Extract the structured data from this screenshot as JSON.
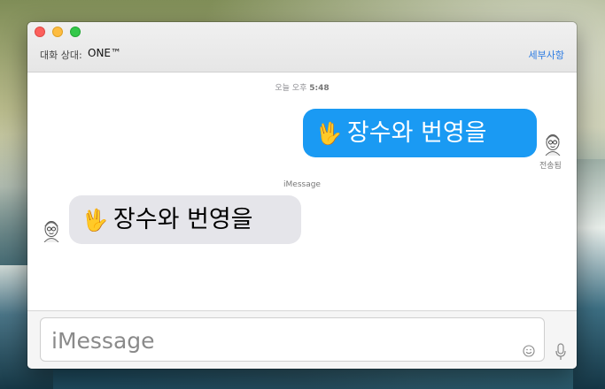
{
  "header": {
    "to_label": "대화 상대:",
    "recipient": "ONE™",
    "details_label": "세부사항"
  },
  "conversation": {
    "timestamp_prefix": "오늘 오후",
    "timestamp_time": "5:48",
    "service_label": "iMessage",
    "messages": [
      {
        "direction": "outgoing",
        "emoji": "🖖",
        "text": "장수와 번영을",
        "sender": "전송됨"
      },
      {
        "direction": "incoming",
        "emoji": "🖖",
        "text": "장수와 번영을"
      }
    ]
  },
  "composer": {
    "placeholder": "iMessage"
  },
  "icons": {
    "emoji_button": "smiley-icon",
    "voice_button": "microphone-icon",
    "avatar": "avatar-icon"
  },
  "colors": {
    "outgoing_bubble": "#1a9af3",
    "incoming_bubble": "#e5e5ea",
    "link": "#2a7ae2"
  }
}
